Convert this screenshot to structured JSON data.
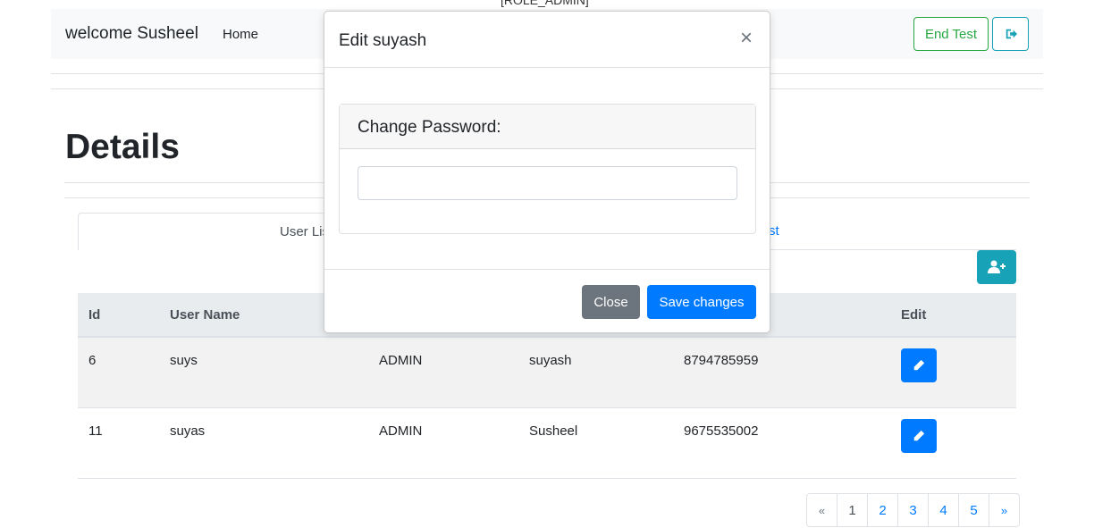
{
  "role_text": "[ROLE_ADMIN]",
  "navbar": {
    "brand": "welcome Susheel",
    "home_link": "Home",
    "end_test_label": "End Test",
    "logout_icon": "sign-out-icon"
  },
  "page": {
    "title": "Details"
  },
  "tabs": [
    {
      "label": "User List",
      "active": true
    },
    {
      "label": "tion List",
      "active": false
    }
  ],
  "add_user_icon": "user-plus-icon",
  "table": {
    "headers": [
      "Id",
      "User Name",
      "",
      "",
      "",
      "Edit"
    ],
    "rows": [
      {
        "id": "6",
        "username": "suys",
        "role": "ADMIN",
        "name": "suyash",
        "phone": "8794785959"
      },
      {
        "id": "11",
        "username": "suyas",
        "role": "ADMIN",
        "name": "Susheel",
        "phone": "9675535002"
      }
    ]
  },
  "pagination": {
    "prev": "«",
    "pages": [
      "1",
      "2",
      "3",
      "4",
      "5"
    ],
    "next": "»",
    "current": "1"
  },
  "modal": {
    "title": "Edit suyash",
    "close_symbol": "×",
    "card_header": "Change Password:",
    "password_value": "",
    "close_label": "Close",
    "save_label": "Save changes"
  },
  "colors": {
    "primary": "#007bff",
    "info": "#17a2b8",
    "success": "#28a745",
    "secondary": "#6c757d"
  }
}
